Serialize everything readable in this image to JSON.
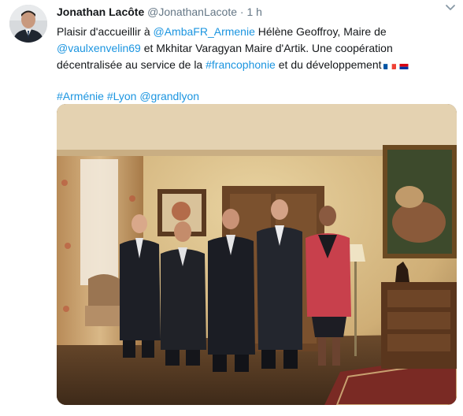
{
  "tweet": {
    "author_name": "Jonathan Lacôte",
    "author_handle": "@JonathanLacote",
    "separator": "·",
    "time": "1 h",
    "text_parts": {
      "p1": "Plaisir d'accueillir à ",
      "mention_ambassade": "@AmbaFR_Armenie",
      "p2": " Hélène Geoffroy, Maire de ",
      "mention_vaulx": "@vaulxenvelin69",
      "p3": " et Mkhitar Varagyan Maire d'Artik. Une coopération décentralisée au service de la ",
      "hashtag_franco": "#francophonie",
      "p4": " et du développement"
    },
    "hashtags": {
      "armenie": "#Arménie",
      "lyon": "#Lyon",
      "grandlyon": "@grandlyon"
    },
    "flags": [
      "france-flag-icon",
      "armenia-flag-icon"
    ]
  },
  "colors": {
    "link": "#1b95e0",
    "text": "#14171a",
    "secondary": "#657786"
  }
}
